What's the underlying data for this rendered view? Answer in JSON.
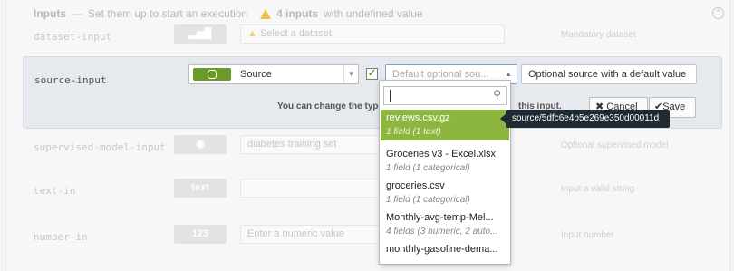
{
  "header": {
    "title": "Inputs",
    "subtitle": "Set them up to start an execution",
    "warning_count": "4 inputs",
    "warning_text": "with undefined value"
  },
  "rows": {
    "dataset": {
      "name": "dataset-input",
      "type": "",
      "value": "Select a dataset",
      "desc": "Mandatory dataset"
    },
    "supervised": {
      "name": "supervised-model-input",
      "type": "",
      "value": "diabetes training set",
      "desc": "Optional supervised model"
    },
    "text": {
      "name": "text-in",
      "type": "text",
      "value": "",
      "desc": "Input a valid string"
    },
    "number": {
      "name": "number-in",
      "type": "123",
      "value": "Enter a numeric value",
      "desc": "Input number"
    }
  },
  "active": {
    "name": "source-input",
    "type_label": "Source",
    "dataset_placeholder": "Default optional sou...",
    "description_value": "Optional source with a default value",
    "help_text": "You can change the type,",
    "help_text2": "this input.",
    "cancel_label": "Cancel",
    "save_label": "Save"
  },
  "dropdown": {
    "options": [
      {
        "title": "reviews.csv.gz",
        "sub": "1 field (1 text)"
      },
      {
        "title": "Groceries v3 - Excel.xlsx",
        "sub": "1 field (1 categorical)"
      },
      {
        "title": "groceries.csv",
        "sub": "1 field (1 categorical)"
      },
      {
        "title": "Monthly-avg-temp-Mel...",
        "sub": "4 fields (3 numeric, 2 auto..."
      },
      {
        "title": "monthly-gasoline-dema...",
        "sub": ""
      }
    ]
  },
  "tooltip": "source/5dfc6e4b5e269e350d00011d",
  "colors": {
    "accent_green": "#8db640",
    "source_badge": "#6a9a2a",
    "tooltip_bg": "#1f2a33"
  }
}
